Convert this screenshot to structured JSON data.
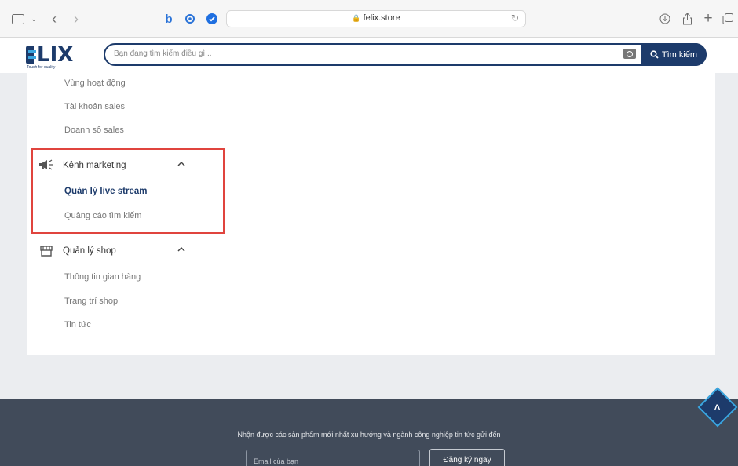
{
  "browser": {
    "url": "felix.store"
  },
  "header": {
    "logo_text": "LIX",
    "logo_tagline": "Touch for quality",
    "search_placeholder": "Bạn đang tìm kiếm điều gì...",
    "search_button": "Tìm kiếm"
  },
  "sidebar": {
    "prev_items": [
      "Vùng hoạt động",
      "Tài khoản sales",
      "Doanh số sales"
    ],
    "marketing": {
      "title": "Kênh marketing",
      "items": [
        "Quản lý live stream",
        "Quảng cáo tìm kiếm"
      ]
    },
    "shop": {
      "title": "Quản lý shop",
      "items": [
        "Thông tin gian hàng",
        "Trang trí shop",
        "Tin tức"
      ]
    }
  },
  "footer": {
    "message": "Nhận được các sản phẩm mới nhất xu hướng và ngành công nghiệp tin tức gửi đến",
    "email_placeholder": "Email của bạn",
    "subscribe": "Đăng ký ngay"
  },
  "colors": {
    "brand": "#1d3b6b",
    "accent": "#3aa6e0",
    "highlight": "#e0443e"
  }
}
